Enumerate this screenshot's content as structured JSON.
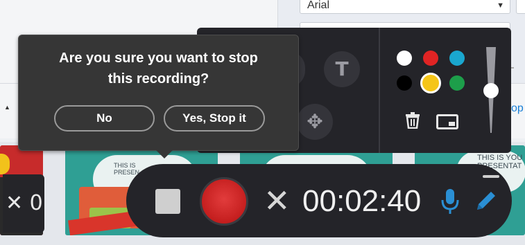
{
  "background": {
    "font_select_value": "Arial",
    "link_peek": "op",
    "thumb_titles": [
      "THIS IS\nPRESEN",
      "THIS IS YOU\nPRESENTAT"
    ],
    "left_peek": "✕ 0"
  },
  "confirm": {
    "message_line1": "Are you sure you want to stop",
    "message_line2": "this recording?",
    "no_label": "No",
    "yes_label": "Yes, Stop it"
  },
  "tools": {
    "text_tool_glyph": "T",
    "move_tool_glyph": "✥",
    "colors": [
      "#ffffff",
      "#e02424",
      "#1aa7cf",
      "#000000",
      "#f5c518",
      "#1d9e4a"
    ],
    "selected_color": "#f5c518",
    "trash_glyph": "🗑"
  },
  "recorder": {
    "timer": "00:02:40",
    "cancel_glyph": "✕",
    "accent_color": "#2a8fd4"
  }
}
